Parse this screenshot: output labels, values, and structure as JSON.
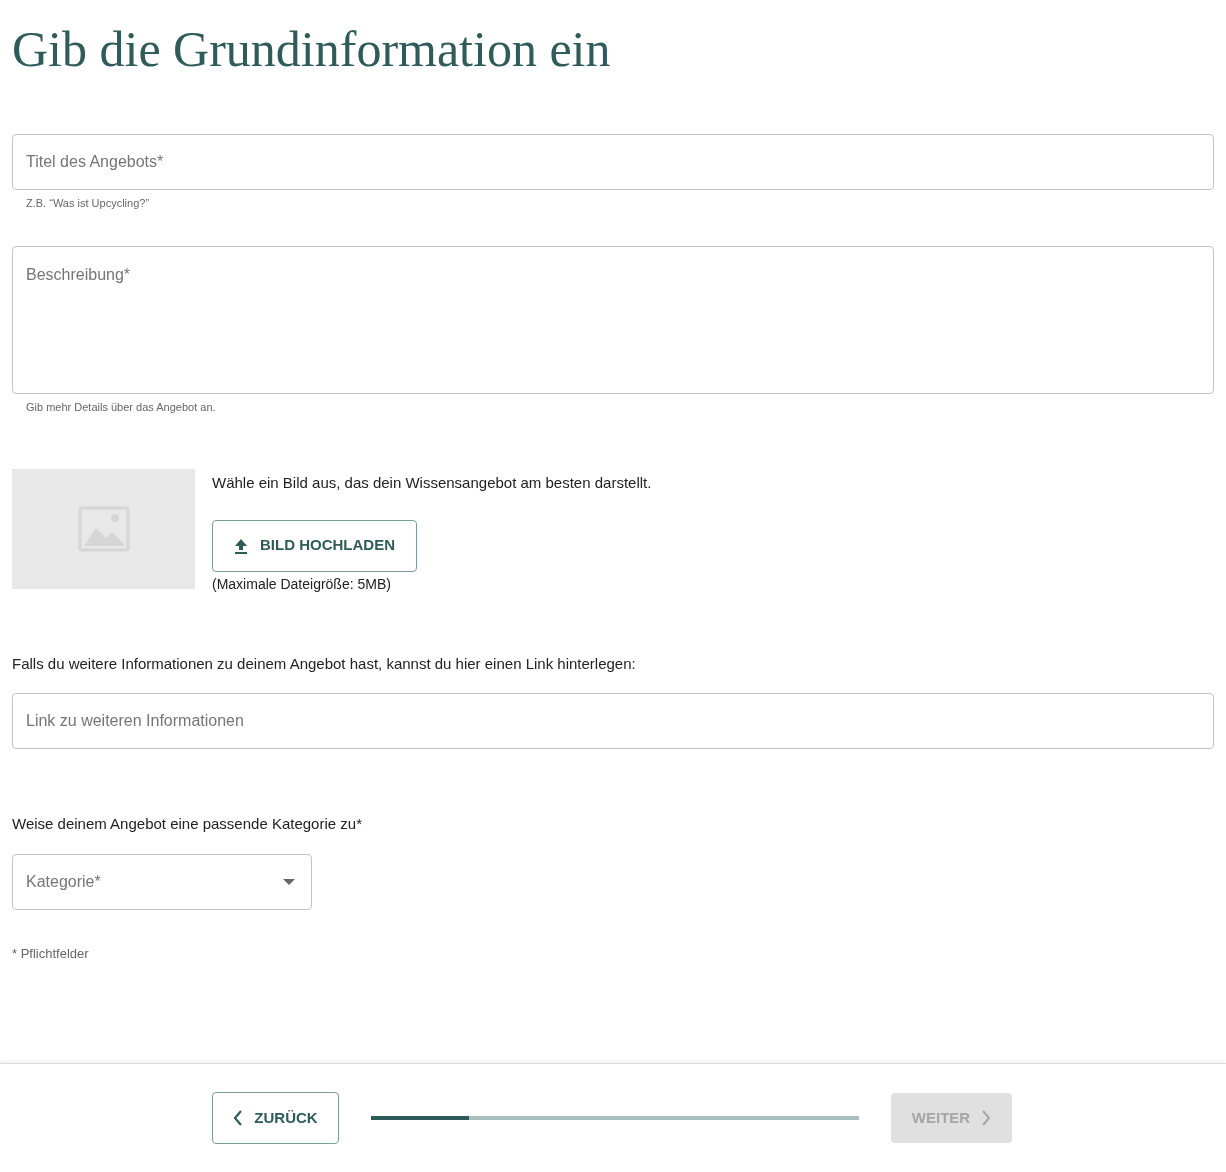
{
  "heading": "Gib die Grundinformation ein",
  "title_field": {
    "placeholder": "Titel des Angebots*",
    "helper": "Z.B. “Was ist Upcycling?”"
  },
  "description_field": {
    "placeholder": "Beschreibung*",
    "helper": "Gib mehr Details über das Angebot an."
  },
  "image": {
    "prompt": "Wähle ein Bild aus, das dein Wissensangebot am besten darstellt.",
    "upload_button": "BILD HOCHLADEN",
    "size_note": "(Maximale Dateigröße: 5MB)"
  },
  "link": {
    "prompt": "Falls du weitere Informationen zu deinem Angebot hast, kannst du hier einen Link hinterlegen:",
    "placeholder": "Link zu weiteren Informationen"
  },
  "category": {
    "prompt": "Weise deinem Angebot eine passende Kategorie zu*",
    "placeholder": "Kategorie*"
  },
  "required_note": "* Pflichtfelder",
  "footer": {
    "back": {
      "label": "ZURÜCK",
      "disabled": false
    },
    "progress": {
      "level": 0.2
    },
    "next": {
      "label": "WEITER",
      "disabled": true
    }
  }
}
